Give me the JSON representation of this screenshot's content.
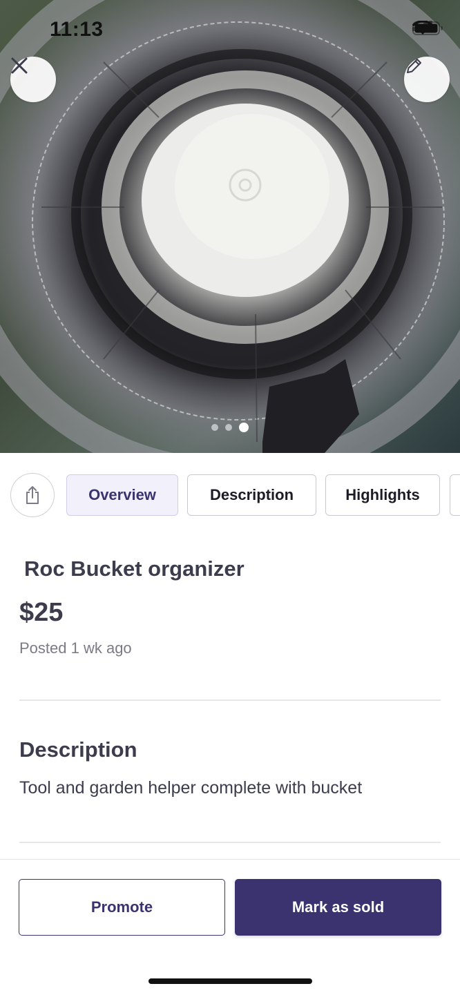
{
  "status_bar": {
    "time": "11:13"
  },
  "hero": {
    "image_alt": "bucket organizer interior",
    "carousel": {
      "count": 3,
      "active_index": 2
    }
  },
  "actions": {
    "close_icon": "close-icon",
    "edit_icon": "pencil-icon",
    "share_icon": "share-icon"
  },
  "tabs": [
    {
      "label": "Overview",
      "active": true
    },
    {
      "label": "Description",
      "active": false
    },
    {
      "label": "Highlights",
      "active": false
    }
  ],
  "listing": {
    "title": "Roc Bucket organizer",
    "price": "$25",
    "posted": "Posted 1 wk ago"
  },
  "description": {
    "heading": "Description",
    "text": "Tool and garden helper complete with bucket"
  },
  "footer": {
    "promote_label": "Promote",
    "mark_sold_label": "Mark as sold"
  },
  "colors": {
    "brand": "#3b3370",
    "tab_active_bg": "#f1f0fb"
  }
}
